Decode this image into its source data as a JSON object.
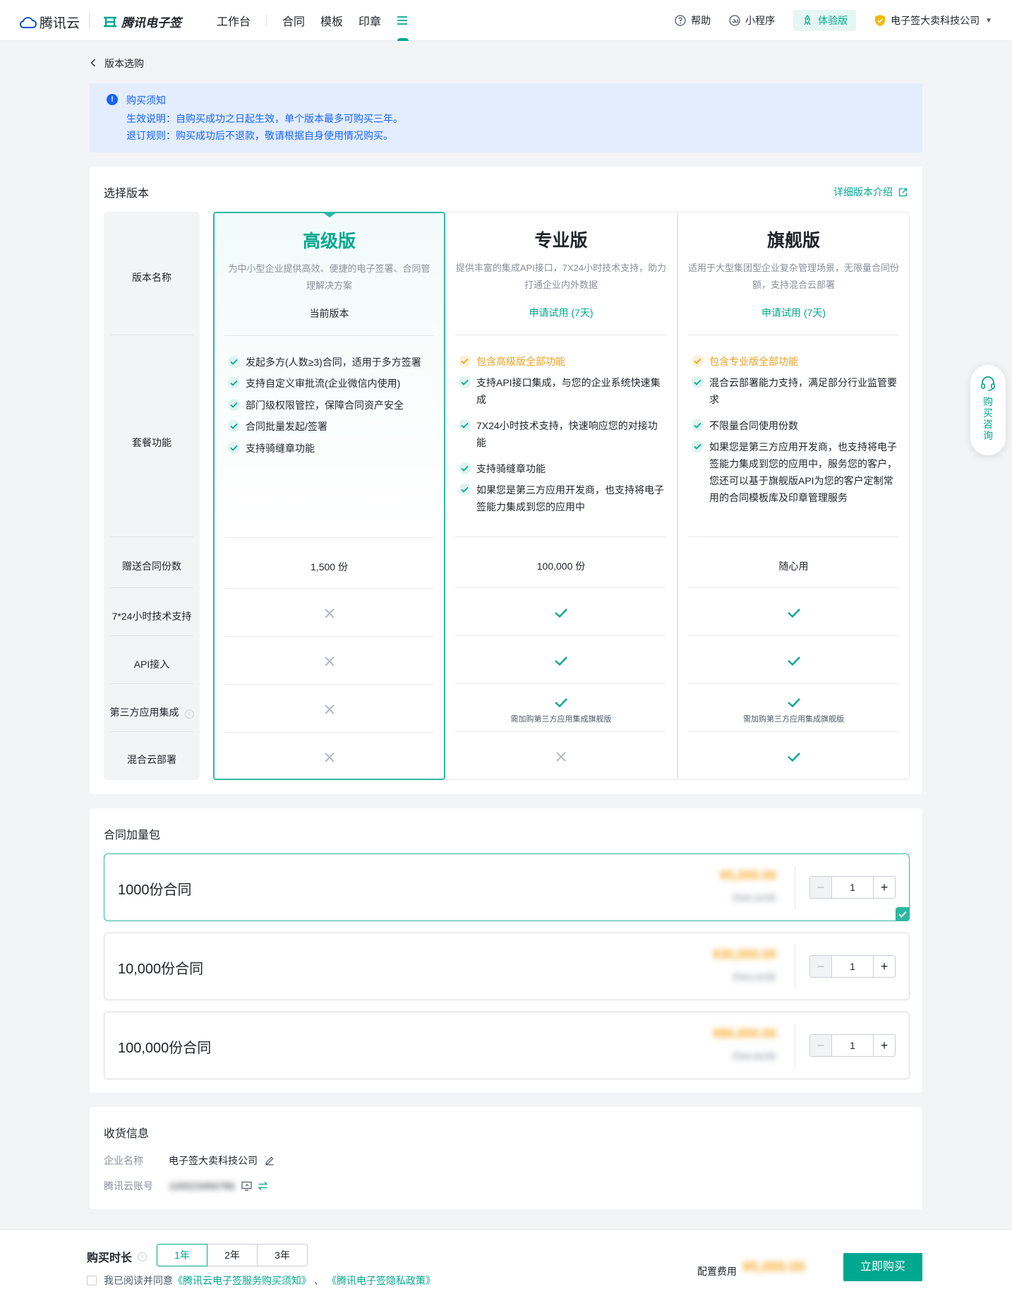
{
  "header": {
    "brand": "腾讯云",
    "product": "腾讯电子签",
    "nav": [
      "工作台",
      "合同",
      "模板",
      "印章"
    ],
    "help": "帮助",
    "miniapp": "小程序",
    "trial": "体验版",
    "company": "电子签大卖科技公司"
  },
  "breadcrumb": "版本选购",
  "notice": {
    "title": "购买须知",
    "line1": "生效说明：自购买成功之日起生效，单个版本最多可购买三年。",
    "line2": "退订规则：购买成功后不退款，敬请根据自身使用情况购买。"
  },
  "versions_section": {
    "title": "选择版本",
    "detail_link": "详细版本介绍",
    "row_labels": {
      "name": "版本名称",
      "features": "套餐功能",
      "contracts": "赠送合同份数",
      "support": "7*24小时技术支持",
      "api": "API接入",
      "thirdparty": "第三方应用集成",
      "hybrid": "混合云部署"
    },
    "versions": [
      {
        "name": "高级版",
        "desc": "为中小型企业提供高效、便捷的电子签署、合同管理解决方案",
        "action": "当前版本",
        "features": [
          "发起多方(人数≥3)合同，适用于多方签署",
          "支持自定义审批流(企业微信内使用)",
          "部门级权限管控，保障合同资产安全",
          "合同批量发起/签署",
          "支持骑缝章功能"
        ],
        "contracts": "1,500 份",
        "support": false,
        "api": false,
        "thirdparty": false,
        "hybrid": false,
        "thirdparty_note": ""
      },
      {
        "name": "专业版",
        "desc": "提供丰富的集成API接口，7X24小时技术支持，助力打通企业内外数据",
        "action": "申请试用 (7天)",
        "inherit": "包含高级版全部功能",
        "features": [
          "支持API接口集成，与您的企业系统快速集成",
          "7X24小时技术支持，快速响应您的对接功能",
          "支持骑缝章功能",
          "如果您是第三方应用开发商，也支持将电子签能力集成到您的应用中"
        ],
        "contracts": "100,000 份",
        "support": true,
        "api": true,
        "thirdparty": true,
        "hybrid": false,
        "thirdparty_note": "需加购第三方应用集成旗舰版"
      },
      {
        "name": "旗舰版",
        "desc": "适用于大型集团型企业复杂管理场景，无限量合同份额，支持混合云部署",
        "action": "申请试用 (7天)",
        "inherit": "包含专业版全部功能",
        "features": [
          "混合云部署能力支持，满足部分行业监管要求",
          "不限量合同使用份数",
          "如果您是第三方应用开发商，也支持将电子签能力集成到您的应用中，服务您的客户，您还可以基于旗舰版API为您的客户定制常用的合同模板库及印章管理服务"
        ],
        "contracts": "随心用",
        "support": true,
        "api": true,
        "thirdparty": true,
        "hybrid": true,
        "thirdparty_note": "需加购第三方应用集成旗舰版"
      }
    ]
  },
  "addon_section": {
    "title": "合同加量包",
    "packages": [
      {
        "name": "1000份合同",
        "price": "¥5,000.00",
        "subprice": "约¥5.00/份",
        "qty": "1",
        "selected": true
      },
      {
        "name": "10,000份合同",
        "price": "¥30,000.00",
        "subprice": "约¥3.00/份",
        "qty": "1",
        "selected": false
      },
      {
        "name": "100,000份合同",
        "price": "¥80,000.00",
        "subprice": "约¥0.80/份",
        "qty": "1",
        "selected": false
      }
    ]
  },
  "receipt": {
    "title": "收货信息",
    "company_label": "企业名称",
    "company_value": "电子签大卖科技公司",
    "account_label": "腾讯云账号",
    "account_value": "100023456789"
  },
  "consult": {
    "label": "购买咨询"
  },
  "footer": {
    "duration_label": "购买时长",
    "durations": [
      "1年",
      "2年",
      "3年"
    ],
    "active_duration": "1年",
    "agree_prefix": "我已阅读并同意",
    "agree_link1": "《腾讯云电子签服务购买须知》",
    "agree_sep": "、",
    "agree_link2": "《腾讯电子签隐私政策》",
    "fee_label": "配置费用",
    "fee_value": "¥5,000.00",
    "buy_label": "立即购买"
  },
  "colors": {
    "accent": "#00a890",
    "notice": "#1664ff",
    "price": "#f7a928"
  }
}
